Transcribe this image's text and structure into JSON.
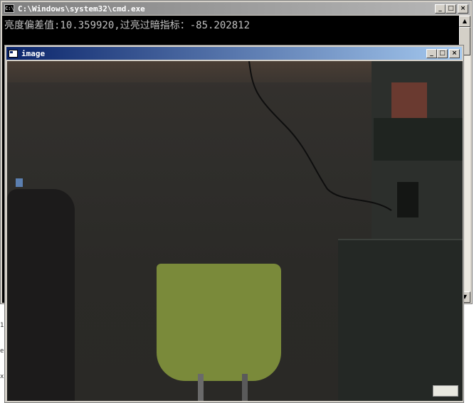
{
  "cmd_window": {
    "title": "C:\\Windows\\system32\\cmd.exe",
    "icon_text": "C:\\",
    "output_line": "亮度偏差值:10.359920,过亮过暗指标：-85.202812",
    "buttons": {
      "minimize": "_",
      "maximize": "□",
      "close": "×"
    },
    "scroll_up": "▲",
    "scroll_down": "▼"
  },
  "image_window": {
    "title": "image",
    "buttons": {
      "minimize": "_",
      "maximize": "□",
      "close": "×"
    }
  },
  "edge_glyphs": [
    "1",
    "e",
    "x"
  ],
  "colors": {
    "cmd_title_inactive": "#808080",
    "image_title_active": "#0a246a",
    "console_bg": "#000000",
    "console_text": "#c0c0c0",
    "chrome": "#d4d0c8"
  }
}
